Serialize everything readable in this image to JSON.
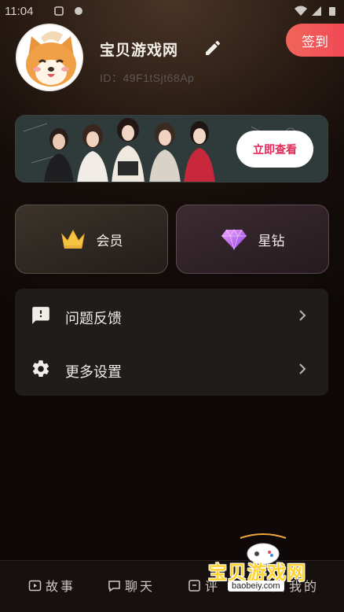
{
  "status_bar": {
    "time": "11:04"
  },
  "profile": {
    "username": "宝贝游戏网",
    "user_id": "ID：49F1tSjt68Ap",
    "checkin_label": "签到"
  },
  "banner": {
    "button_label": "立即查看"
  },
  "cards": {
    "member_label": "会员",
    "diamond_label": "星钻"
  },
  "menu": [
    {
      "label": "问题反馈",
      "icon": "feedback-icon"
    },
    {
      "label": "更多设置",
      "icon": "settings-icon"
    }
  ],
  "tabs": [
    {
      "label": "故事",
      "icon": "story-icon"
    },
    {
      "label": "聊天",
      "icon": "chat-icon"
    },
    {
      "label": "评",
      "icon": "comment-icon"
    },
    {
      "label": "我的",
      "icon": "profile-icon"
    }
  ],
  "watermark": {
    "title": "宝贝游戏网",
    "url": "baobeiy.com"
  },
  "colors": {
    "accent": "#f04f57",
    "banner_button_text": "#e22a58",
    "gold": "#f5c542",
    "diamond": "#c35cf0"
  }
}
